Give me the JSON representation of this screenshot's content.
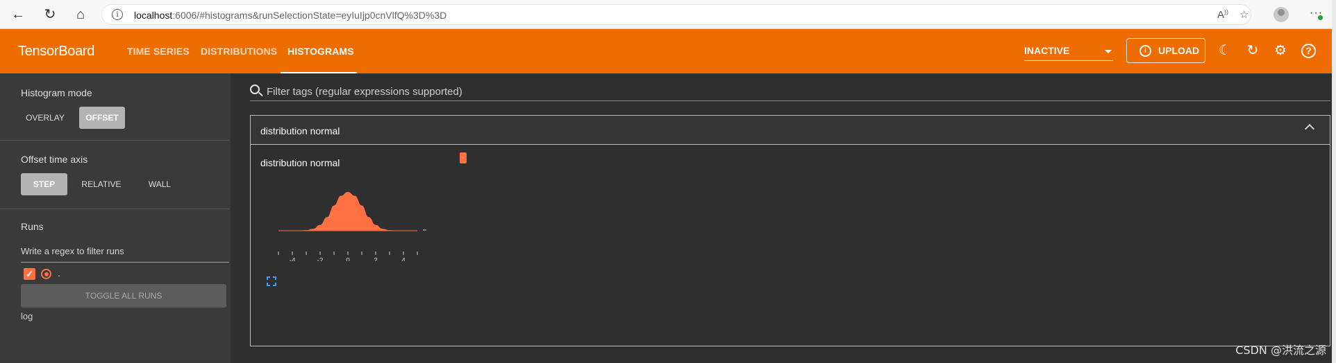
{
  "browser": {
    "url_host": "localhost",
    "url_rest": ":6006/#histograms&runSelectionState=eyIuIjp0cnVlfQ%3D%3D",
    "icons": [
      "back-icon",
      "reload-icon",
      "home-icon",
      "info-icon",
      "read-aloud-icon",
      "favorites-icon",
      "profile-icon",
      "more-icon"
    ]
  },
  "toolbar": {
    "brand": "TensorBoard",
    "tabs": [
      {
        "label": "TIME SERIES"
      },
      {
        "label": "DISTRIBUTIONS"
      },
      {
        "label": "HISTOGRAMS"
      }
    ],
    "active_tab": "HISTOGRAMS",
    "reload_status": "INACTIVE",
    "upload_label": "UPLOAD",
    "accent_color": "#ef6c00"
  },
  "sidebar": {
    "histogram_mode_label": "Histogram mode",
    "histogram_mode_options": [
      "OVERLAY",
      "OFFSET"
    ],
    "histogram_mode_selected": "OFFSET",
    "time_axis_label": "Offset time axis",
    "time_axis_options": [
      "STEP",
      "RELATIVE",
      "WALL"
    ],
    "time_axis_selected": "STEP",
    "runs_label": "Runs",
    "runs_filter_placeholder": "Write a regex to filter runs",
    "run": {
      "name": ".",
      "checked": true,
      "color": "#ff7043"
    },
    "toggle_all_label": "TOGGLE ALL RUNS",
    "log_dir": "log"
  },
  "main": {
    "filter_placeholder": "Filter tags (regular expressions supported)",
    "group_title": "distribution normal",
    "card_title": "distribution normal",
    "run_chip": ".",
    "expand_icon": "fullscreen-icon"
  },
  "chart_data": {
    "type": "area",
    "title": "distribution normal",
    "x_tick_labels": [
      "-4",
      "-2",
      "0",
      "2",
      "4"
    ],
    "xlim": [
      -5,
      5
    ],
    "x": [
      -5,
      -4.5,
      -4,
      -3.5,
      -3,
      -2.5,
      -2,
      -1.5,
      -1,
      -0.5,
      0,
      0.5,
      1,
      1.5,
      2,
      2.5,
      3,
      3.5,
      4,
      4.5,
      5
    ],
    "series": [
      {
        "values": [
          0,
          0,
          0,
          0.002,
          0.005,
          0.02,
          0.06,
          0.14,
          0.26,
          0.36,
          0.4,
          0.36,
          0.26,
          0.14,
          0.06,
          0.02,
          0.005,
          0.002,
          0,
          0,
          0
        ],
        "color": "#ff7043"
      }
    ],
    "grid": false,
    "legend": "none"
  },
  "watermark": "CSDN @洪流之源"
}
